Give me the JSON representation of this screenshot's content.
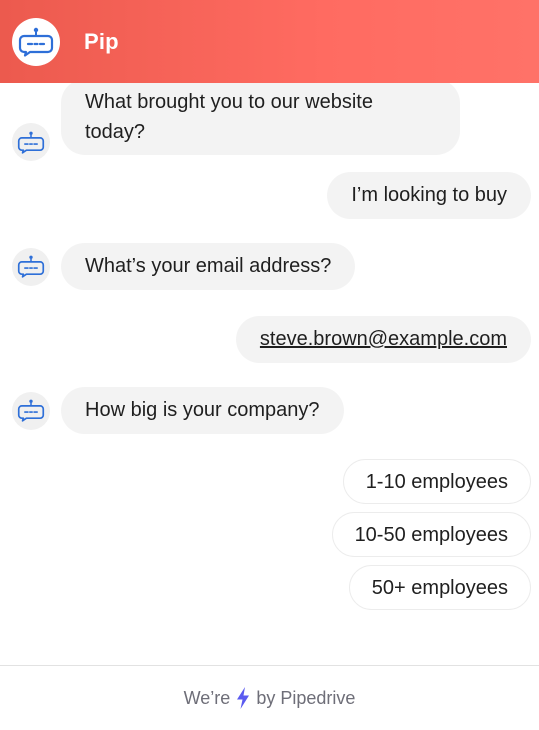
{
  "header": {
    "title": "Pip",
    "avatar_icon": "bot-icon"
  },
  "colors": {
    "header_start": "#ec5a4e",
    "header_end": "#ff7268",
    "bot_icon": "#2e6fd8",
    "bolt": "#5b5bf0"
  },
  "messages": [
    {
      "from": "bot",
      "text": "What brought you to our website today?"
    },
    {
      "from": "user",
      "text": "I’m looking to buy"
    },
    {
      "from": "bot",
      "text": "What’s your email address?"
    },
    {
      "from": "user",
      "text": "steve.brown@example.com"
    },
    {
      "from": "bot",
      "text": "How big is your company?"
    }
  ],
  "options": [
    "1-10 employees",
    "10-50 employees",
    "50+ employees"
  ],
  "footer": {
    "prefix": "We’re",
    "suffix": "by Pipedrive",
    "icon": "bolt-icon"
  }
}
